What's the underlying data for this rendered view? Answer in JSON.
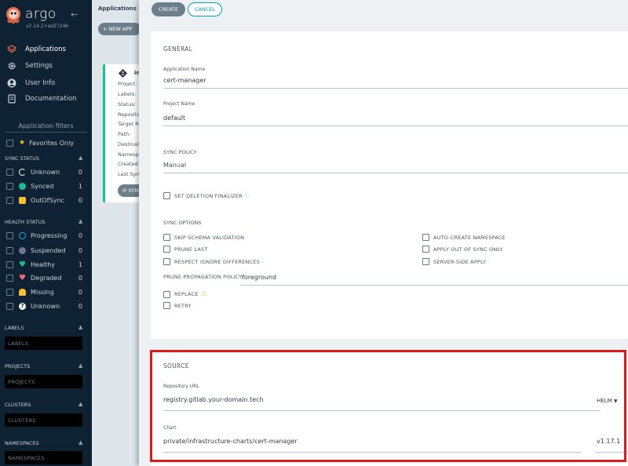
{
  "app": {
    "brand": "argo",
    "version": "v2.14.2+ad27246"
  },
  "nav": [
    {
      "label": "Applications",
      "icon": "layers-icon"
    },
    {
      "label": "Settings",
      "icon": "gear-icon"
    },
    {
      "label": "User Info",
      "icon": "user-icon"
    },
    {
      "label": "Documentation",
      "icon": "book-icon"
    }
  ],
  "filters": {
    "title": "Application filters",
    "favorites": "Favorites Only",
    "sync_status": {
      "title": "SYNC STATUS",
      "items": [
        {
          "label": "Unknown",
          "count": "0",
          "color": "#ffffff"
        },
        {
          "label": "Synced",
          "count": "1",
          "color": "#18be94"
        },
        {
          "label": "OutOfSync",
          "count": "0",
          "color": "#f4c030"
        }
      ]
    },
    "health_status": {
      "title": "HEALTH STATUS",
      "items": [
        {
          "label": "Progressing",
          "count": "0",
          "color": "#0dadea"
        },
        {
          "label": "Suspended",
          "count": "0",
          "color": "#766f94"
        },
        {
          "label": "Healthy",
          "count": "1",
          "color": "#18be94"
        },
        {
          "label": "Degraded",
          "count": "0",
          "color": "#e96d76"
        },
        {
          "label": "Missing",
          "count": "0",
          "color": "#f4c030"
        },
        {
          "label": "Unknown",
          "count": "0",
          "color": "#ffffff"
        }
      ]
    },
    "labels": {
      "title": "LABELS",
      "placeholder": "LABELS"
    },
    "projects": {
      "title": "PROJECTS",
      "placeholder": "PROJECTS"
    },
    "clusters": {
      "title": "CLUSTERS",
      "placeholder": "CLUSTERS"
    },
    "namespaces": {
      "title": "NAMESPACES",
      "placeholder": "NAMESPACES"
    }
  },
  "apps": {
    "title": "Applications",
    "new_app": "+ NEW APP",
    "card": {
      "name": "in",
      "fields": [
        "Project:",
        "Labels:",
        "Status:",
        "Repositor",
        "Target Re",
        "Path:",
        "Destinati",
        "Namespa",
        "Created A",
        "Last Sync"
      ],
      "sync": "SYNC"
    }
  },
  "panel": {
    "create": "CREATE",
    "cancel": "CANCEL",
    "general": {
      "title": "GENERAL",
      "app_name_label": "Application Name",
      "app_name_value": "cert-manager",
      "project_label": "Project Name",
      "project_value": "default",
      "sync_policy_label": "SYNC POLICY",
      "sync_policy_value": "Manual",
      "deletion_finalizer": "SET DELETION FINALIZER",
      "sync_options_title": "SYNC OPTIONS",
      "options_left": [
        "SKIP SCHEMA VALIDATION",
        "PRUNE LAST",
        "RESPECT IGNORE DIFFERENCES"
      ],
      "options_right": [
        "AUTO-CREATE NAMESPACE",
        "APPLY OUT OF SYNC ONLY",
        "SERVER-SIDE APPLY"
      ],
      "prune_policy_label": "PRUNE PROPAGATION POLICY:",
      "prune_policy_value": "foreground",
      "replace": "REPLACE",
      "retry": "RETRY"
    },
    "source": {
      "title": "SOURCE",
      "repo_label": "Repository URL",
      "repo_value": "registry.gitlab.your-domain.tech",
      "repo_type": "HELM",
      "chart_label": "Chart",
      "chart_value": "private/infrastructure-charts/cert-manager",
      "chart_version": "v1.17.1"
    }
  }
}
